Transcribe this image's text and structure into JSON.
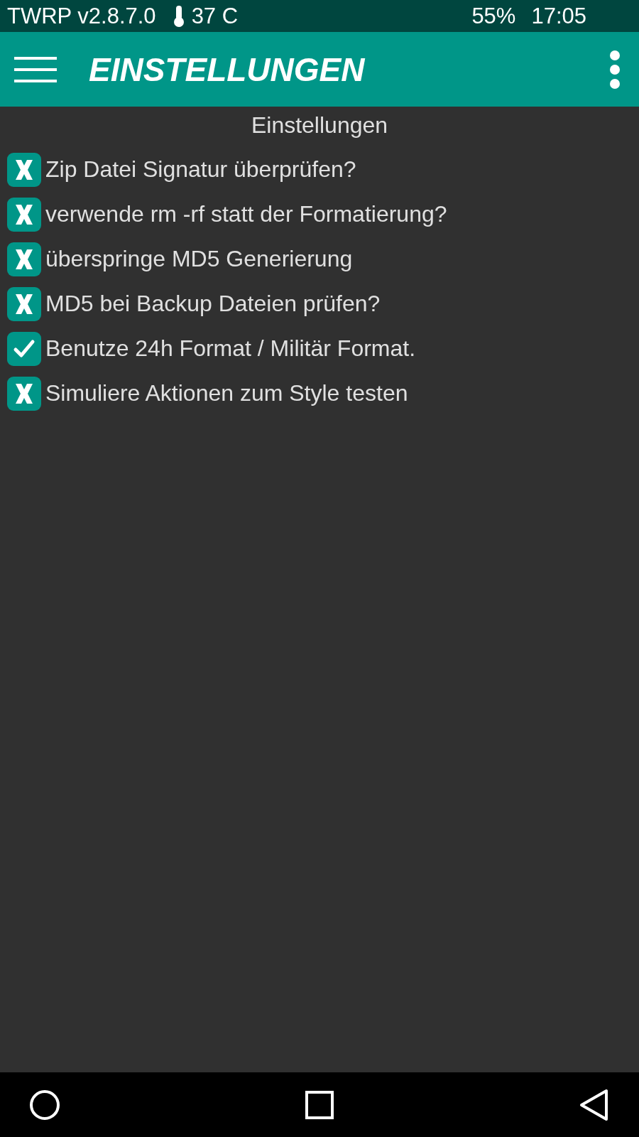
{
  "status_bar": {
    "version": "TWRP v2.8.7.0",
    "temperature": "37 C",
    "battery": "55%",
    "time": "17:05"
  },
  "header": {
    "title": "EINSTELLUNGEN"
  },
  "section_title": "Einstellungen",
  "options": [
    {
      "label": "Zip Datei Signatur überprüfen?",
      "checked": false
    },
    {
      "label": "verwende rm -rf statt der Formatierung?",
      "checked": false
    },
    {
      "label": "überspringe MD5 Generierung",
      "checked": false
    },
    {
      "label": "MD5 bei Backup Dateien prüfen?",
      "checked": false
    },
    {
      "label": "Benutze 24h Format / Militär Format.",
      "checked": true
    },
    {
      "label": "Simuliere Aktionen zum Style testen",
      "checked": false
    }
  ]
}
